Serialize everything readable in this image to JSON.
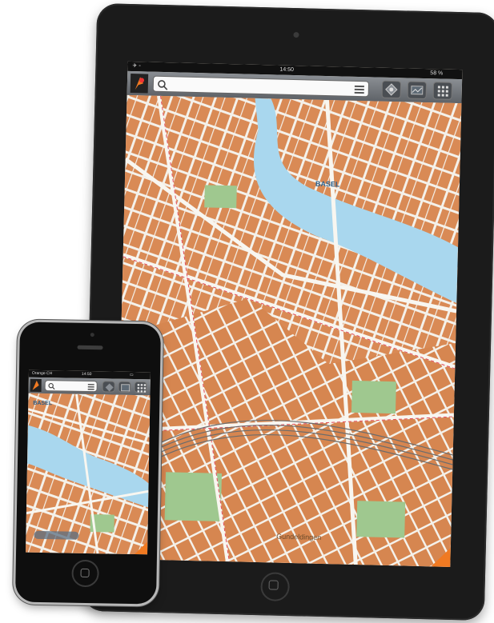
{
  "ipad": {
    "status": {
      "time": "14:50",
      "battery": "58 %"
    },
    "map_labels": {
      "city": "BASEL",
      "district": "Gundeldingen"
    },
    "icons": {
      "search": "search-icon",
      "list": "list-icon",
      "locate": "locate-icon",
      "layers": "layers-icon",
      "grid": "grid-icon",
      "zoom": "zoom-icon"
    }
  },
  "iphone": {
    "status": {
      "carrier": "Orange CH",
      "time": "14:50"
    },
    "map_labels": {
      "city": "BASEL"
    }
  },
  "colors": {
    "buildings": "#d98a55",
    "water": "#a9d7ee",
    "streets": "#f4f1ea",
    "parks": "#9fc88f",
    "bezel": "#1b1b1b"
  }
}
